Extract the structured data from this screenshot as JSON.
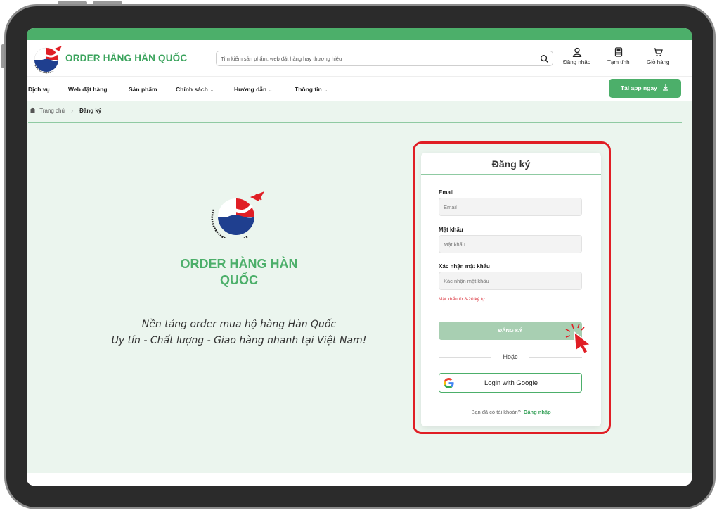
{
  "header": {
    "brand": "ORDER HÀNG HÀN QUỐC",
    "search_placeholder": "Tìm kiếm sản phẩm, web đặt hàng hay thương hiệu",
    "login_label": "Đăng nhập",
    "estimate_label": "Tạm tính",
    "cart_label": "Giỏ hàng"
  },
  "nav": {
    "items": [
      "Dịch vụ",
      "Web đặt hàng",
      "Sản phẩm",
      "Chính sách",
      "Hướng dẫn",
      "Thông tin"
    ],
    "app_button": "Tải app ngay"
  },
  "breadcrumb": {
    "home": "Trang chủ",
    "current": "Đăng ký"
  },
  "hero": {
    "title": "ORDER HÀNG HÀN QUỐC",
    "subtitle_line1": "Nền tảng order mua hộ hàng Hàn Quốc",
    "subtitle_line2": "Uy tín - Chất lượng - Giao hàng nhanh tại Việt Nam!"
  },
  "form": {
    "title": "Đăng ký",
    "email_label": "Email",
    "email_placeholder": "Email",
    "password_label": "Mật khẩu",
    "password_placeholder": "Mật khẩu",
    "confirm_label": "Xác nhận mật khẩu",
    "confirm_placeholder": "Xác nhận mật khẩu",
    "password_hint": "Mật khẩu từ 8-20 ký tự",
    "submit_label": "ĐĂNG KÝ",
    "or_label": "Hoặc",
    "google_label": "Login with Google",
    "already_text": "Bạn đã có tài khoản?",
    "login_link": "Đăng nhập"
  },
  "colors": {
    "brand_green": "#4caf6a",
    "highlight_red": "#e01e25",
    "content_bg": "#ebf5ee"
  },
  "icons": [
    "search-icon",
    "user-icon",
    "calculator-icon",
    "cart-icon",
    "download-icon",
    "home-icon",
    "chevron-right-icon",
    "chevron-down-icon",
    "google-icon",
    "cursor-click-icon"
  ]
}
